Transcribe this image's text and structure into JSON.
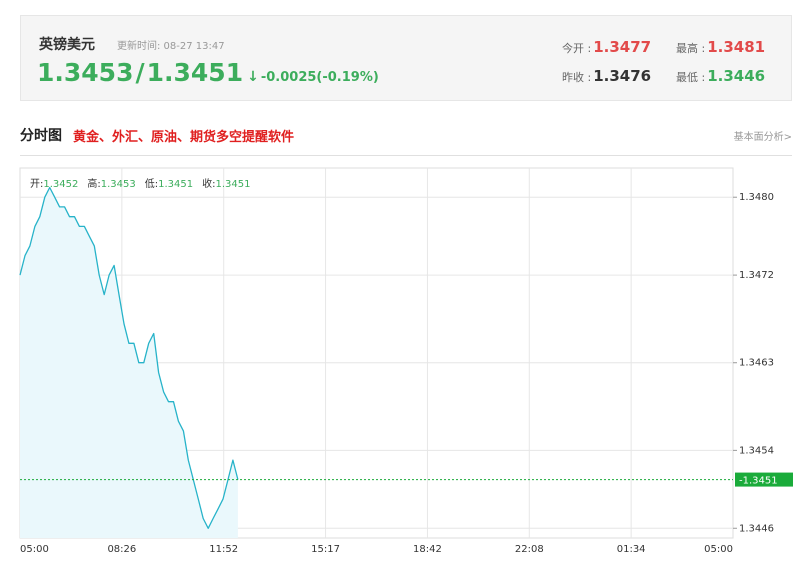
{
  "quote": {
    "name": "英镑美元",
    "update_label": "更新时间: 08-27 13:47",
    "bid": "1.3453",
    "sep": "/",
    "ask": "1.3451",
    "arrow": "↓",
    "change": "-0.0025(-0.19%)",
    "open_label": "今开 :",
    "open": "1.3477",
    "high_label": "最高 :",
    "high": "1.3481",
    "prev_close_label": "昨收 :",
    "prev_close": "1.3476",
    "low_label": "最低 :",
    "low": "1.3446"
  },
  "tabs": {
    "title": "分时图",
    "promo": "黄金、外汇、原油、期货多空提醒软件",
    "link": "基本面分析>"
  },
  "ohlc": {
    "open_label": "开:",
    "open": "1.3452",
    "high_label": "高:",
    "high": "1.3453",
    "low_label": "低:",
    "low": "1.3451",
    "close_label": "收:",
    "close": "1.3451"
  },
  "colors": {
    "line": "#27b3c9",
    "fill": "#eaf8fc",
    "current": "#1aab3a",
    "grid": "#e6e6e6"
  },
  "chart_data": {
    "type": "area",
    "x_ticks": [
      "05:00",
      "08:26",
      "11:52",
      "15:17",
      "18:42",
      "22:08",
      "01:34",
      "05:00"
    ],
    "y_ticks": [
      "1.3480",
      "1.3472",
      "1.3463",
      "1.3454",
      "1.3446"
    ],
    "ylim": [
      1.3445,
      1.3483
    ],
    "current": "1.3451",
    "session_minutes": 1440,
    "x_minutes": [
      0,
      10,
      20,
      30,
      40,
      50,
      60,
      70,
      80,
      90,
      100,
      110,
      120,
      130,
      140,
      150,
      160,
      170,
      180,
      190,
      200,
      210,
      220,
      230,
      240,
      250,
      260,
      270,
      280,
      290,
      300,
      310,
      320,
      330,
      340,
      350,
      360,
      370,
      380,
      390,
      400,
      410,
      420,
      430,
      440,
      450,
      460,
      470,
      480,
      490,
      500,
      510,
      520
    ],
    "values": [
      1.3472,
      1.3474,
      1.3475,
      1.3477,
      1.3478,
      1.348,
      1.3481,
      1.348,
      1.3479,
      1.3479,
      1.3478,
      1.3478,
      1.3477,
      1.3477,
      1.3476,
      1.3475,
      1.3472,
      1.347,
      1.3472,
      1.3473,
      1.347,
      1.3467,
      1.3465,
      1.3465,
      1.3463,
      1.3463,
      1.3465,
      1.3466,
      1.3462,
      1.346,
      1.3459,
      1.3459,
      1.3457,
      1.3456,
      1.3453,
      1.3451,
      1.3449,
      1.3447,
      1.3446,
      1.3447,
      1.3448,
      1.3449,
      1.3451,
      1.3453,
      1.3451
    ],
    "grid": true
  }
}
